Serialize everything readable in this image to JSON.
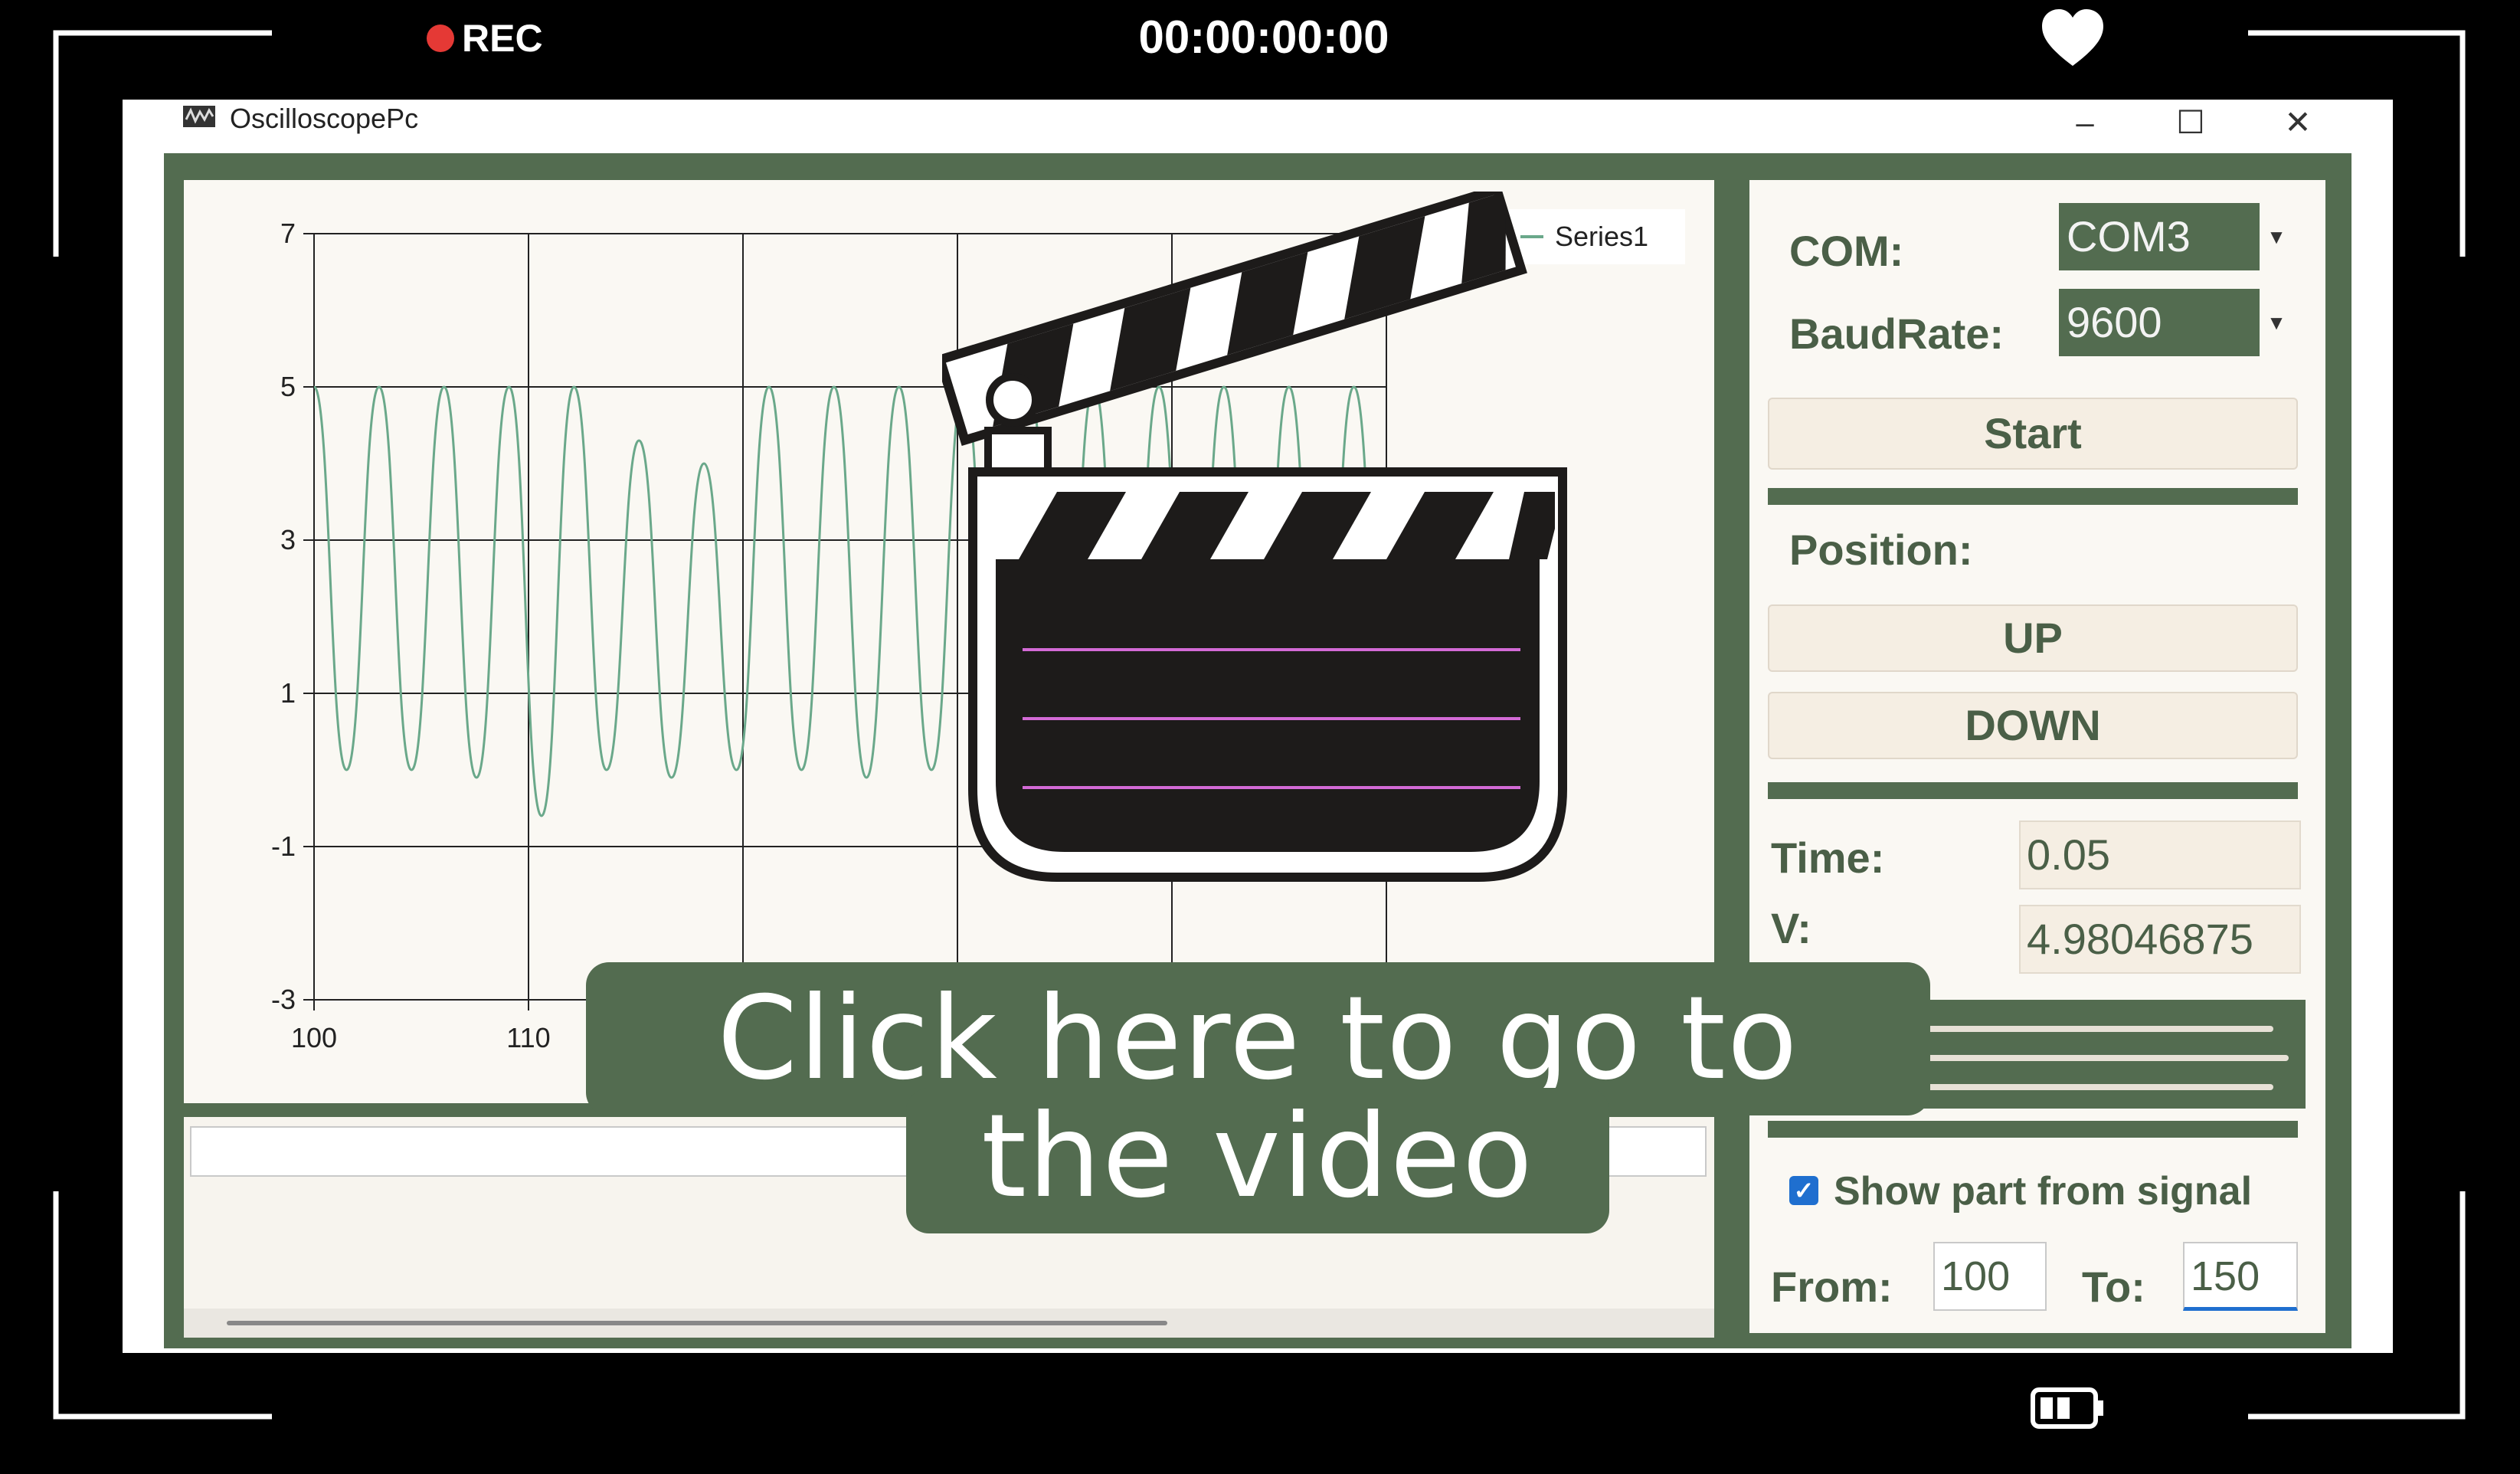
{
  "recorder": {
    "rec_label": "REC",
    "timecode": "00:00:00:00"
  },
  "window": {
    "title": "OscilloscopePc",
    "minimize": "–",
    "maximize": "☐",
    "close": "✕"
  },
  "chart_data": {
    "type": "line",
    "series": [
      {
        "name": "Series1",
        "color": "#6aa88a"
      }
    ],
    "y_ticks": [
      "7",
      "5",
      "3",
      "1",
      "-1",
      "-3"
    ],
    "x_ticks": [
      "100",
      "110"
    ],
    "ylim": [
      -3,
      7
    ],
    "xlim": [
      100,
      150
    ],
    "grid": true,
    "legend_placement": "top-right",
    "y": [
      5,
      0,
      5,
      0,
      5,
      -0.1,
      5,
      -0.6,
      5,
      0,
      4.3,
      -0.1,
      4,
      0,
      5,
      0,
      5,
      -0.1,
      5,
      0,
      5,
      -0.2,
      5,
      0,
      5,
      0,
      5,
      0,
      5,
      0,
      5,
      0,
      5,
      0
    ]
  },
  "controls": {
    "com_label": "COM:",
    "com_value": "COM3",
    "baud_label": "BaudRate:",
    "baud_value": "9600",
    "start_button": "Start",
    "position_label": "Position:",
    "up_button": "UP",
    "down_button": "DOWN",
    "time_label": "Time:",
    "time_value": "0.05",
    "v_label": "V:",
    "v_value": "4.98046875",
    "show_part_label": "Show part from signal",
    "show_part_checked": true,
    "from_label": "From:",
    "from_value": "100",
    "to_label": "To:",
    "to_value": "150"
  },
  "overlay": {
    "line1": "Click here to go to",
    "line2": "the video"
  },
  "colors": {
    "frame_green": "#536c50",
    "panel_beige": "#faf8f3",
    "button_beige": "#f5eee3",
    "series": "#6aa88a",
    "rec_red": "#e53935"
  }
}
